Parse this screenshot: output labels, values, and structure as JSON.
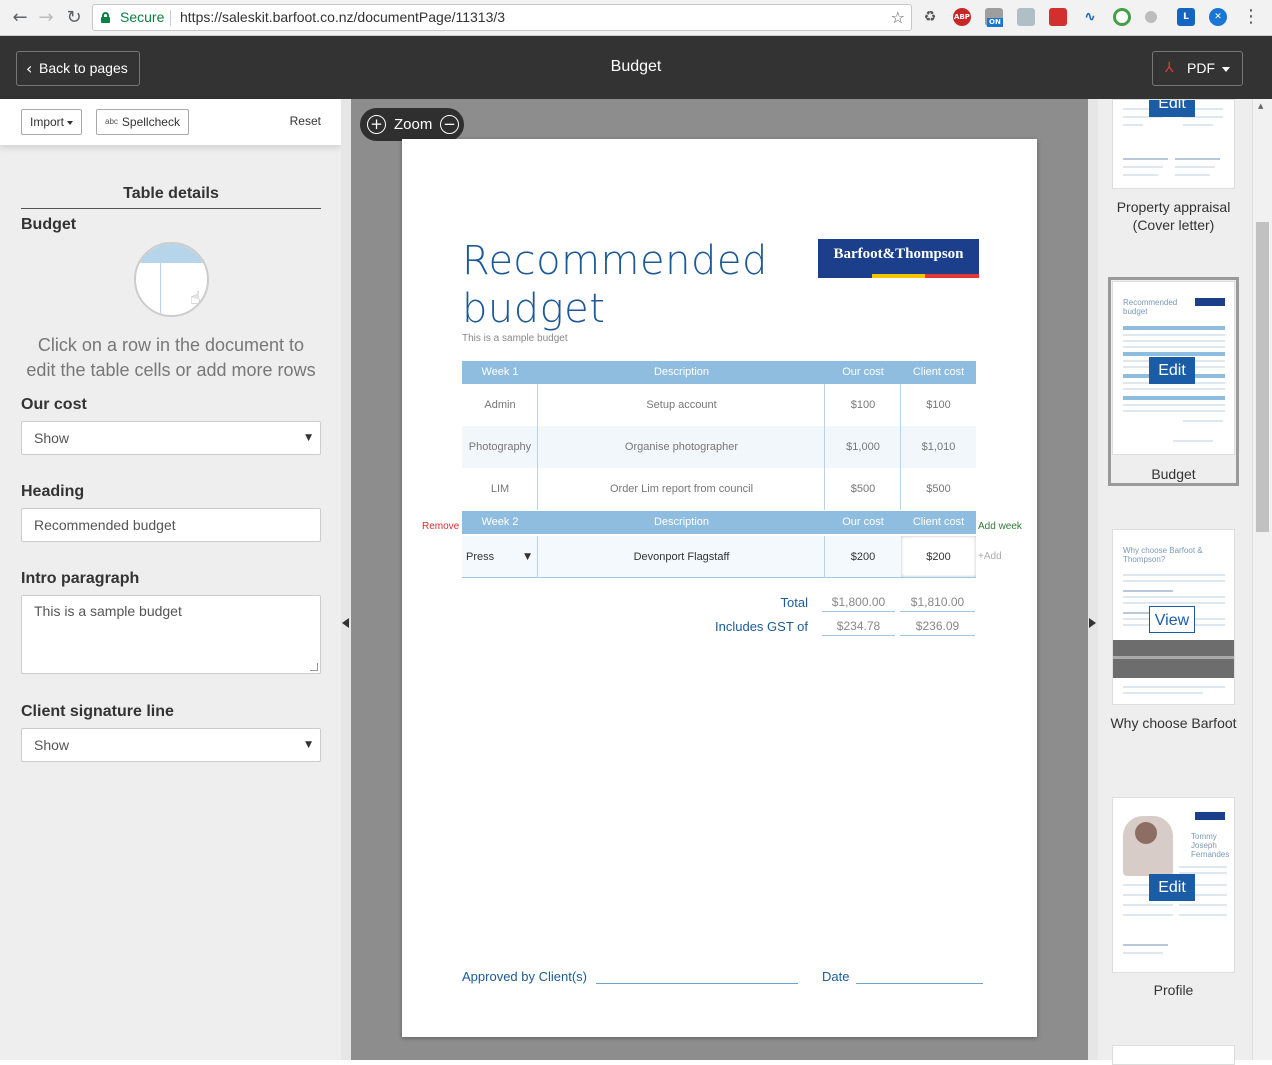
{
  "browser": {
    "secure_label": "Secure",
    "url": "https://saleskit.barfoot.co.nz/documentPage/11313/3",
    "abp_badge": "ABP",
    "on_badge": "ON"
  },
  "header": {
    "back_label": "Back to pages",
    "title": "Budget",
    "pdf_label": "PDF"
  },
  "toolbar": {
    "import_label": "Import",
    "spellcheck_icon_text": "abc",
    "spellcheck_label": "Spellcheck",
    "reset_label": "Reset"
  },
  "left_panel": {
    "section_title": "Table details",
    "budget_label": "Budget",
    "hint": "Click on a row in the document to edit the table cells or add more rows",
    "our_cost": {
      "label": "Our cost",
      "value": "Show"
    },
    "heading": {
      "label": "Heading",
      "value": "Recommended budget"
    },
    "intro": {
      "label": "Intro paragraph",
      "value": "This is a sample budget"
    },
    "client_signature": {
      "label": "Client signature line",
      "value": "Show"
    }
  },
  "zoom": {
    "label": "Zoom"
  },
  "document": {
    "heading_line1": "Recommended",
    "heading_line2": "budget",
    "intro": "This is a sample budget",
    "logo_text": "Barfoot&Thompson",
    "logo_colors": [
      "#1b3f8b",
      "#f2c500",
      "#e53935"
    ],
    "columns": [
      "Description",
      "Our cost",
      "Client cost"
    ],
    "weeks": [
      {
        "label": "Week 1",
        "rows": [
          {
            "category": "Admin",
            "description": "Setup account",
            "our_cost": "$100",
            "client_cost": "$100"
          },
          {
            "category": "Photography",
            "description": "Organise photographer",
            "our_cost": "$1,000",
            "client_cost": "$1,010"
          },
          {
            "category": "LIM",
            "description": "Order Lim report from council",
            "our_cost": "$500",
            "client_cost": "$500"
          }
        ]
      },
      {
        "label": "Week 2",
        "rows": [
          {
            "category": "Press",
            "description": "Devonport Flagstaff",
            "our_cost": "$200",
            "client_cost": "$200"
          }
        ]
      }
    ],
    "remove_label": "Remove",
    "add_week_label": "Add week",
    "add_label": "+Add",
    "total_label": "Total",
    "total_our": "$1,800.00",
    "total_client": "$1,810.00",
    "gst_label": "Includes GST of",
    "gst_our": "$234.78",
    "gst_client": "$236.09",
    "approved_label": "Approved by Client(s)",
    "date_label": "Date"
  },
  "pages": [
    {
      "label": "Property appraisal (Cover letter)",
      "action": "Edit"
    },
    {
      "label": "Budget",
      "action": "Edit",
      "selected": true
    },
    {
      "label": "Why choose Barfoot",
      "action": "View"
    },
    {
      "label": "Profile",
      "action": "Edit"
    }
  ],
  "thumb_text": {
    "budget_title": "Recommended budget",
    "why_title": "Why choose Barfoot & Thompson?",
    "profile_name": "Tommy Joseph Fernandes"
  },
  "colors": {
    "accent": "#1d5a95",
    "table_header": "#8fbde0",
    "app_header": "#333333"
  }
}
